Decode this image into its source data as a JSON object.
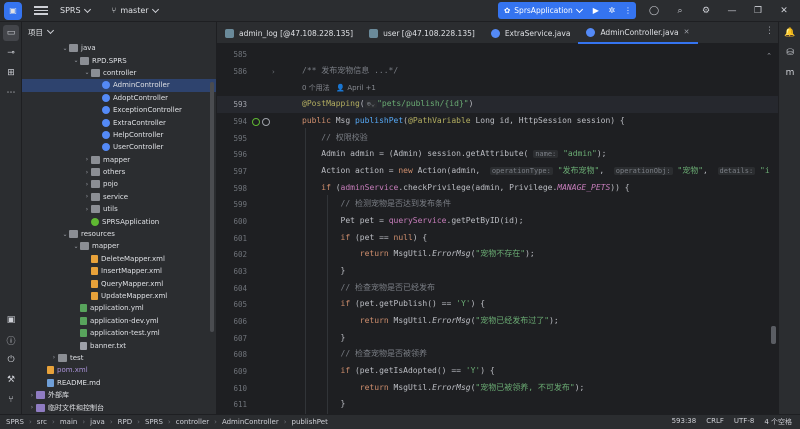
{
  "titlebar": {
    "project": "SPRS",
    "branch": "master",
    "run_config": "SprsApplication"
  },
  "project_panel": {
    "title": "项目",
    "tree": [
      {
        "label": "java",
        "icon": "folder",
        "indent": 3,
        "arrow": "v"
      },
      {
        "label": "RPD.SPRS",
        "icon": "folder",
        "indent": 4,
        "arrow": "v"
      },
      {
        "label": "controller",
        "icon": "folder",
        "indent": 5,
        "arrow": "v"
      },
      {
        "label": "AdminController",
        "icon": "cls",
        "indent": 6,
        "arrow": "",
        "selected": true
      },
      {
        "label": "AdoptController",
        "icon": "cls",
        "indent": 6,
        "arrow": ""
      },
      {
        "label": "ExceptionController",
        "icon": "cls",
        "indent": 6,
        "arrow": ""
      },
      {
        "label": "ExtraController",
        "icon": "cls",
        "indent": 6,
        "arrow": ""
      },
      {
        "label": "HelpController",
        "icon": "cls",
        "indent": 6,
        "arrow": ""
      },
      {
        "label": "UserController",
        "icon": "cls",
        "indent": 6,
        "arrow": ""
      },
      {
        "label": "mapper",
        "icon": "folder",
        "indent": 5,
        "arrow": ">"
      },
      {
        "label": "others",
        "icon": "folder",
        "indent": 5,
        "arrow": ">"
      },
      {
        "label": "pojo",
        "icon": "folder",
        "indent": 5,
        "arrow": ">"
      },
      {
        "label": "service",
        "icon": "folder",
        "indent": 5,
        "arrow": ">"
      },
      {
        "label": "utils",
        "icon": "folder",
        "indent": 5,
        "arrow": ">"
      },
      {
        "label": "SPRSApplication",
        "icon": "spring",
        "indent": 5,
        "arrow": ""
      },
      {
        "label": "resources",
        "icon": "folder",
        "indent": 3,
        "arrow": "v"
      },
      {
        "label": "mapper",
        "icon": "folder",
        "indent": 4,
        "arrow": "v"
      },
      {
        "label": "DeleteMapper.xml",
        "icon": "xml",
        "indent": 5,
        "arrow": ""
      },
      {
        "label": "InsertMapper.xml",
        "icon": "xml",
        "indent": 5,
        "arrow": ""
      },
      {
        "label": "QueryMapper.xml",
        "icon": "xml",
        "indent": 5,
        "arrow": ""
      },
      {
        "label": "UpdateMapper.xml",
        "icon": "xml",
        "indent": 5,
        "arrow": ""
      },
      {
        "label": "application.yml",
        "icon": "yml",
        "indent": 4,
        "arrow": ""
      },
      {
        "label": "application-dev.yml",
        "icon": "yml",
        "indent": 4,
        "arrow": ""
      },
      {
        "label": "application-test.yml",
        "icon": "yml",
        "indent": 4,
        "arrow": ""
      },
      {
        "label": "banner.txt",
        "icon": "txt",
        "indent": 4,
        "arrow": ""
      },
      {
        "label": "test",
        "icon": "folder",
        "indent": 2,
        "arrow": ">"
      },
      {
        "label": "pom.xml",
        "icon": "xml",
        "indent": 1,
        "arrow": ""
      },
      {
        "label": "README.md",
        "icon": "md",
        "indent": 1,
        "arrow": ""
      },
      {
        "label": "外部库",
        "icon": "lib",
        "indent": 0,
        "arrow": ">"
      },
      {
        "label": "临时文件和控制台",
        "icon": "lib",
        "indent": 0,
        "arrow": ">"
      }
    ]
  },
  "tabs": [
    {
      "label": "admin_log [@47.108.228.135]",
      "icon": "db"
    },
    {
      "label": "user [@47.108.228.135]",
      "icon": "db"
    },
    {
      "label": "ExtraService.java",
      "icon": "c"
    },
    {
      "label": "AdminController.java",
      "icon": "c",
      "active": true
    }
  ],
  "editor": {
    "line_numbers": [
      "585",
      "586",
      "",
      "593",
      "594",
      "595",
      "596",
      "597",
      "598",
      "599",
      "600",
      "601",
      "602",
      "603",
      "604",
      "605",
      "606",
      "607",
      "608",
      "609",
      "610",
      "611"
    ],
    "lens": {
      "usages": "0 个用法",
      "author": "April +1"
    }
  },
  "status": {
    "crumbs": [
      "SPRS",
      "src",
      "main",
      "java",
      "RPD",
      "SPRS",
      "controller",
      "AdminController",
      "publishPet"
    ],
    "position": "593:38",
    "line_sep": "CRLF",
    "encoding": "UTF-8",
    "indent": "4 个空格"
  }
}
